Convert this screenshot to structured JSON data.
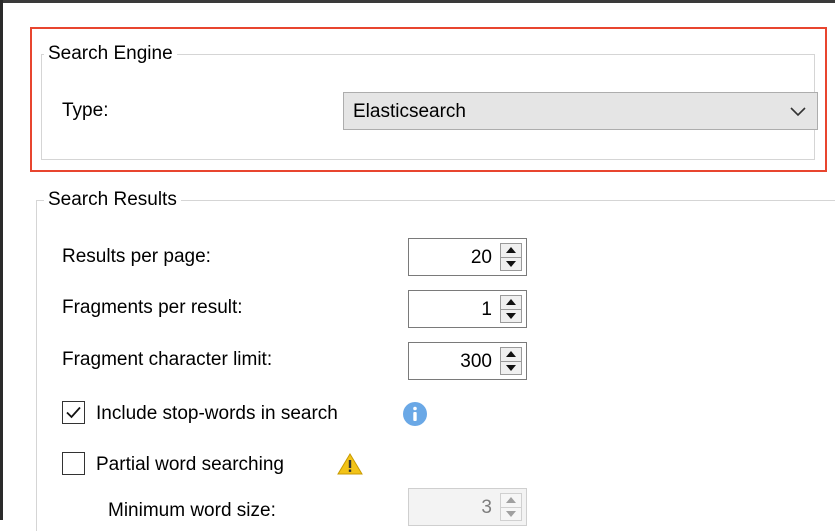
{
  "search_engine": {
    "group_title": "Search Engine",
    "type_label": "Type:",
    "type_value": "Elasticsearch"
  },
  "search_results": {
    "group_title": "Search Results",
    "fields": [
      {
        "label": "Results per page:",
        "value": "20"
      },
      {
        "label": "Fragments per result:",
        "value": "1"
      },
      {
        "label": "Fragment character limit:",
        "value": "300"
      }
    ],
    "include_stopwords": {
      "label": "Include stop-words in search",
      "checked": true
    },
    "partial_word": {
      "label": "Partial word searching",
      "checked": false
    },
    "min_word_size": {
      "label": "Minimum word size:",
      "value": "3",
      "disabled": true
    }
  },
  "colors": {
    "highlight_border": "#e8452f",
    "info_icon": "#6aa8e6",
    "warning_icon": "#f2c318"
  },
  "icons": [
    "chevron-down-icon",
    "info-icon",
    "warning-icon",
    "checkmark-icon",
    "spin-up-icon",
    "spin-down-icon"
  ]
}
